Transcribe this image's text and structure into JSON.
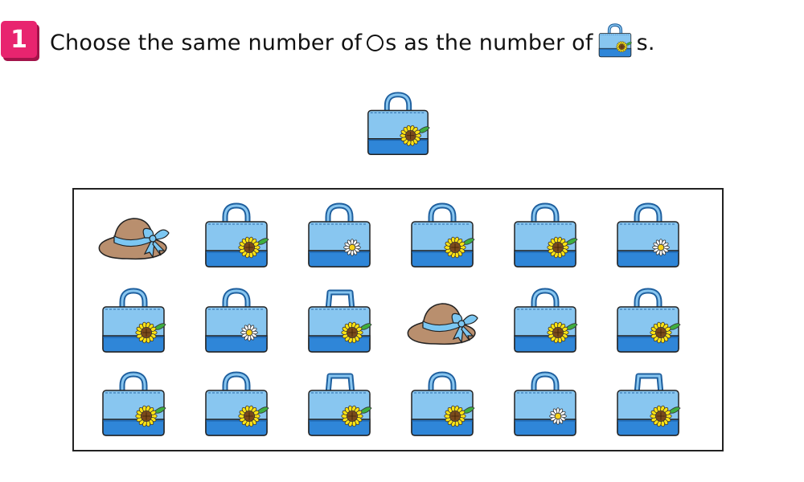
{
  "question": {
    "number": "1",
    "text_before": "Choose the same number of ",
    "text_middle": "s as the number of ",
    "text_after": "s.",
    "circle_icon": "circle-outline",
    "bag_icon": "bag-sunflower-icon"
  },
  "reference": {
    "icon": "bag-sunflower-icon",
    "handle": "round",
    "flower": "sunflower"
  },
  "colors": {
    "bag_light": "#88c6f0",
    "bag_dark": "#2f86d8",
    "outline": "#1e5f9e",
    "hat_brim": "#b98f6e",
    "ribbon": "#7cc7f2",
    "sunflower_petal": "#ffe313",
    "sunflower_center": "#7a4a1b",
    "daisy_petal": "#ffffff",
    "daisy_center": "#f7d21a",
    "badge": "#e8246f"
  },
  "grid": {
    "rows": [
      [
        {
          "kind": "hat"
        },
        {
          "kind": "bag",
          "handle": "round",
          "flower": "sunflower"
        },
        {
          "kind": "bag",
          "handle": "round",
          "flower": "daisy"
        },
        {
          "kind": "bag",
          "handle": "round",
          "flower": "sunflower"
        },
        {
          "kind": "bag",
          "handle": "round",
          "flower": "sunflower"
        },
        {
          "kind": "bag",
          "handle": "round",
          "flower": "daisy"
        }
      ],
      [
        {
          "kind": "bag",
          "handle": "round",
          "flower": "sunflower"
        },
        {
          "kind": "bag",
          "handle": "round",
          "flower": "daisy"
        },
        {
          "kind": "bag",
          "handle": "square",
          "flower": "sunflower"
        },
        {
          "kind": "hat"
        },
        {
          "kind": "bag",
          "handle": "round",
          "flower": "sunflower"
        },
        {
          "kind": "bag",
          "handle": "round",
          "flower": "sunflower"
        }
      ],
      [
        {
          "kind": "bag",
          "handle": "round",
          "flower": "sunflower"
        },
        {
          "kind": "bag",
          "handle": "round",
          "flower": "sunflower"
        },
        {
          "kind": "bag",
          "handle": "square",
          "flower": "sunflower"
        },
        {
          "kind": "bag",
          "handle": "round",
          "flower": "sunflower"
        },
        {
          "kind": "bag",
          "handle": "round",
          "flower": "daisy"
        },
        {
          "kind": "bag",
          "handle": "square",
          "flower": "sunflower"
        }
      ]
    ]
  }
}
